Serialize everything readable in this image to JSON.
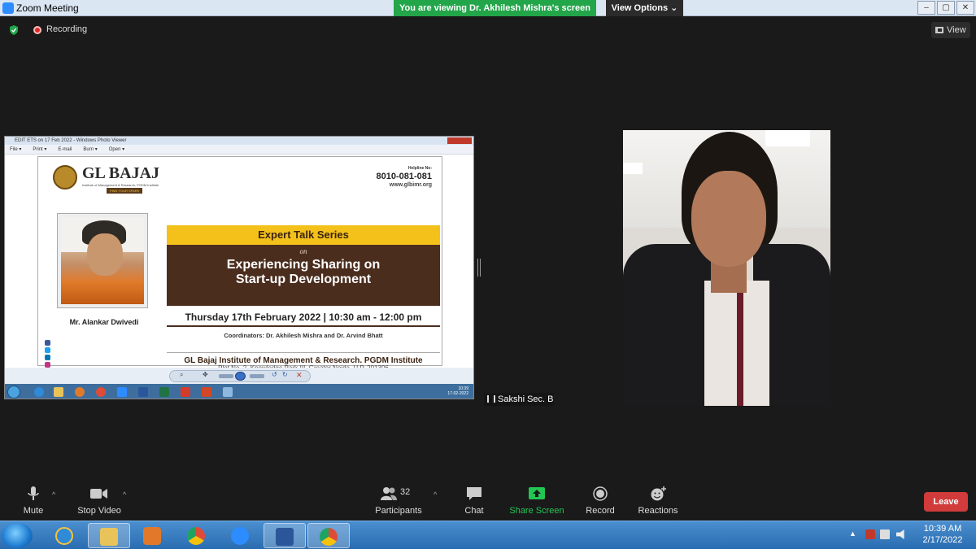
{
  "window": {
    "title": "Zoom Meeting",
    "viewing_banner": "You are viewing Dr. Akhilesh Mishra's screen",
    "view_options": "View Options ⌄"
  },
  "topbar": {
    "recording_label": "Recording",
    "view_label": "View"
  },
  "shared_screen": {
    "window_title": "EDIT ETS on 17 Feb 2022 - Windows Photo Viewer",
    "menu": [
      "File ▾",
      "Print ▾",
      "E-mail",
      "Burn ▾",
      "Open ▾"
    ],
    "poster": {
      "logo": "GL BAJAJ",
      "logo_subtitle": "Institute of Management & Research, PGDM Institute",
      "logo_tag": "FIND YOUR SPARK",
      "helpline_label": "Helpline No:",
      "helpline_number": "8010-081-081",
      "website": "www.glbimr.org",
      "series": "Expert Talk Series",
      "on": "on",
      "title_line1": "Experiencing Sharing on",
      "title_line2": "Start-up Development",
      "datetime": "Thursday 17th February 2022 | 10:30 am - 12:00 pm",
      "coordinators": "Coordinators: Dr. Akhilesh Mishra and Dr. Arvind Bhatt",
      "institute": "GL Bajaj Institute of Management & Research. PGDM Institute",
      "address": "Plot No. 2, Knowledge Park-III, Greater Noida, U.P. 201306",
      "speaker": "Mr. Alankar Dwivedi"
    },
    "clock_time": "10:39",
    "clock_date": "17-02-2022"
  },
  "participant": {
    "name": "Sakshi Sec. B"
  },
  "controls": {
    "mute": "Mute",
    "stop_video": "Stop Video",
    "participants": "Participants",
    "participants_count": "32",
    "chat": "Chat",
    "share_screen": "Share Screen",
    "record": "Record",
    "reactions": "Reactions",
    "leave": "Leave"
  },
  "taskbar": {
    "time": "10:39 AM",
    "date": "2/17/2022"
  },
  "colors": {
    "banner_green": "#23a54a",
    "leave_red": "#d13b3b",
    "share_green": "#23c553",
    "poster_brown": "#4b2d1e",
    "poster_yellow": "#f3c11a"
  }
}
